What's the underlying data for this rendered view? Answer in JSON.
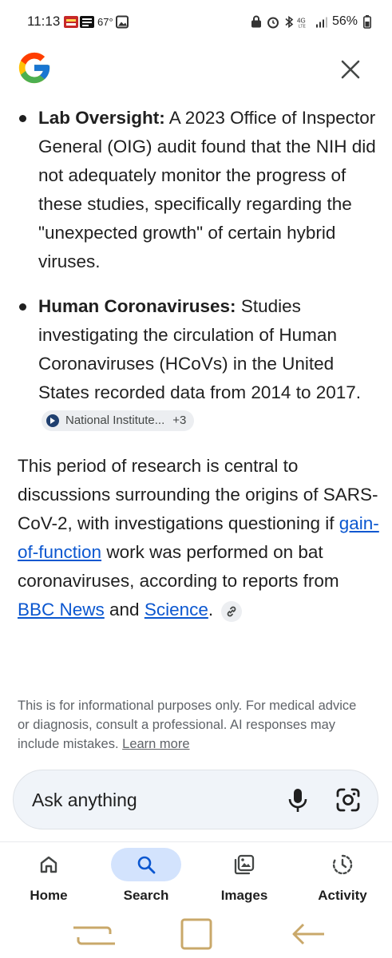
{
  "status_bar": {
    "time": "11:13",
    "temperature": "67°",
    "battery": "56%"
  },
  "header": {
    "logo": "google-g-logo",
    "close_icon": "close-icon"
  },
  "answer": {
    "bullets": [
      {
        "title": "Lab Oversight:",
        "text": " A 2023 Office of Inspector General (OIG) audit found that the NIH did not adequately monitor the progress of these studies, specifically regarding the \"unexpected growth\" of certain hybrid viruses."
      },
      {
        "title": "Human Coronaviruses:",
        "text": " Studies investigating the circulation of Human Coronaviruses (HCoVs) in the United States recorded data from 2014 to 2017.",
        "source_chip": {
          "label": "National Institute...",
          "more": "+3"
        }
      }
    ],
    "paragraph": {
      "part1": "This period of research is central to discussions surrounding the origins of SARS-CoV-2, with investigations questioning if ",
      "link1": "gain-of-function",
      "part2": " work was performed on bat coronaviruses, according to reports from ",
      "link2": "BBC News",
      "part3": " and ",
      "link3": "Science",
      "part4": "."
    }
  },
  "disclaimer": {
    "text": "This is for informational purposes only. For medical advice or diagnosis, consult a professional. AI responses may include mistakes. ",
    "learn_more": "Learn more"
  },
  "ask_bar": {
    "placeholder": "Ask anything"
  },
  "bottom_nav": {
    "items": [
      {
        "label": "Home",
        "icon": "home-icon",
        "active": false
      },
      {
        "label": "Search",
        "icon": "search-icon",
        "active": true
      },
      {
        "label": "Images",
        "icon": "images-icon",
        "active": false
      },
      {
        "label": "Activity",
        "icon": "activity-icon",
        "active": false
      }
    ]
  },
  "colors": {
    "link": "#0b57d0",
    "active_nav": "#d3e3fd",
    "ask_bar_bg": "#f0f4f9"
  }
}
